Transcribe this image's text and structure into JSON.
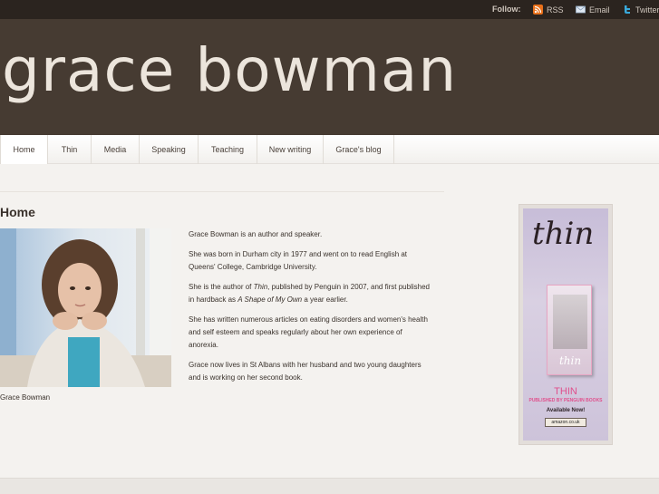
{
  "follow": {
    "label": "Follow:",
    "items": [
      {
        "label": "RSS",
        "icon": "rss-icon"
      },
      {
        "label": "Email",
        "icon": "email-icon"
      },
      {
        "label": "Twitter",
        "icon": "twitter-icon"
      }
    ]
  },
  "site": {
    "title": "grace bowman"
  },
  "nav": {
    "items": [
      {
        "label": "Home"
      },
      {
        "label": "Thin"
      },
      {
        "label": "Media"
      },
      {
        "label": "Speaking"
      },
      {
        "label": "Teaching"
      },
      {
        "label": "New writing"
      },
      {
        "label": "Grace's blog"
      }
    ]
  },
  "main": {
    "title": "Home",
    "photo_caption": "Grace Bowman",
    "paragraphs": [
      "Grace Bowman is an author and speaker.",
      "She was born in Durham city in 1977 and went on to read English at Queens' College, Cambridge University.",
      {
        "before": "She is the author of ",
        "em1": "Thin",
        "middle": ", published by Penguin in 2007, and first published in hardback as ",
        "em2": "A Shape of My Own",
        "after": " a year earlier."
      },
      "She has written numerous articles on eating disorders and women's health and self esteem and speaks regularly about her own experience of anorexia.",
      "Grace now lives in St Albans with her husband and two young daughters and is working on her second book."
    ]
  },
  "ad": {
    "title": "thin",
    "line1": "THIN",
    "line2": "PUBLISHED BY PENGUIN BOOKS",
    "line3": "Available Now!",
    "retailer": "amazon.co.uk"
  },
  "colors": {
    "header_bg": "#463b32",
    "topbar_bg": "#2b241f",
    "title_color": "#ece5dc",
    "page_bg": "#f4f2ef"
  }
}
